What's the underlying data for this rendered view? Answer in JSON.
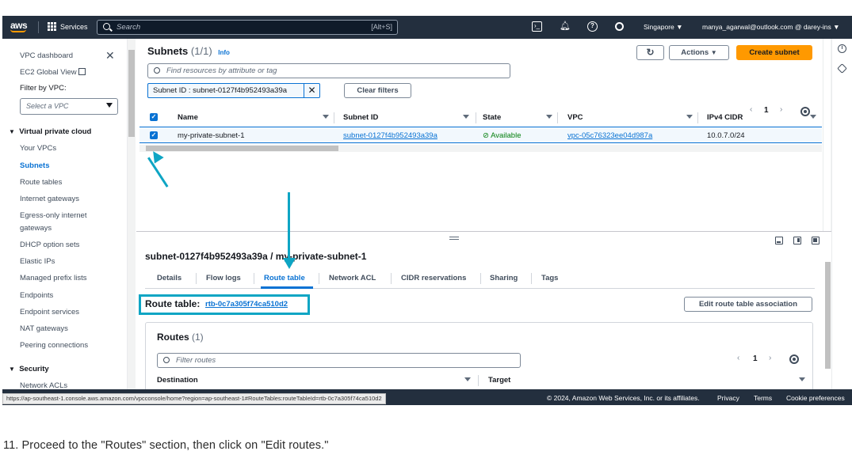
{
  "topnav": {
    "logo": "aws",
    "services": "Services",
    "search_placeholder": "Search",
    "search_shortcut": "[Alt+S]",
    "region": "Singapore ▼",
    "account": "manya_agarwal@outlook.com @ darey-ins ▼"
  },
  "sidebar": {
    "items": [
      "VPC dashboard",
      "EC2 Global View",
      "Filter by VPC:"
    ],
    "select_placeholder": "Select a VPC",
    "section_vpc": "Virtual private cloud",
    "vpc_items": [
      "Your VPCs",
      "Subnets",
      "Route tables",
      "Internet gateways",
      "Egress-only internet",
      "gateways",
      "DHCP option sets",
      "Elastic IPs",
      "Managed prefix lists",
      "Endpoints",
      "Endpoint services",
      "NAT gateways",
      "Peering connections"
    ],
    "section_security": "Security",
    "security_items": [
      "Network ACLs"
    ]
  },
  "subnets": {
    "title": "Subnets",
    "count": "(1/1)",
    "info": "Info",
    "refresh_icon": "refresh-icon",
    "actions": "Actions",
    "create": "Create subnet",
    "find_placeholder": "Find resources by attribute or tag",
    "token": "Subnet ID : subnet-0127f4b952493a39a",
    "clear_filters": "Clear filters",
    "page": "1",
    "columns": [
      "Name",
      "Subnet ID",
      "State",
      "VPC",
      "IPv4 CIDR"
    ],
    "row": {
      "name": "my-private-subnet-1",
      "subnet_id": "subnet-0127f4b952493a39a",
      "state": "Available",
      "vpc": "vpc-05c76323ee04d987a",
      "cidr": "10.0.7.0/24"
    }
  },
  "detail": {
    "title": "subnet-0127f4b952493a39a / my-private-subnet-1",
    "tabs": [
      "Details",
      "Flow logs",
      "Route table",
      "Network ACL",
      "CIDR reservations",
      "Sharing",
      "Tags"
    ],
    "route_table_label": "Route table:",
    "route_table_id": "rtb-0c7a305f74ca510d2",
    "edit_assoc": "Edit route table association",
    "routes_title": "Routes",
    "routes_count": "(1)",
    "filter_placeholder": "Filter routes",
    "page": "1",
    "columns": [
      "Destination",
      "Target"
    ]
  },
  "footer": {
    "status_url": "https://ap-southeast-1.console.aws.amazon.com/vpcconsole/home?region=ap-southeast-1#RouteTables:routeTableId=rtb-0c7a305f74ca510d2",
    "copyright": "© 2024, Amazon Web Services, Inc. or its affiliates.",
    "privacy": "Privacy",
    "terms": "Terms",
    "cookies": "Cookie preferences"
  },
  "caption": "11.  Proceed to the \"Routes\" section, then click on \"Edit routes.\"",
  "colors": {
    "nav": "#232f3e",
    "accent": "#0972d3",
    "primary": "#ff9900",
    "annotation": "#0ea5c4"
  }
}
